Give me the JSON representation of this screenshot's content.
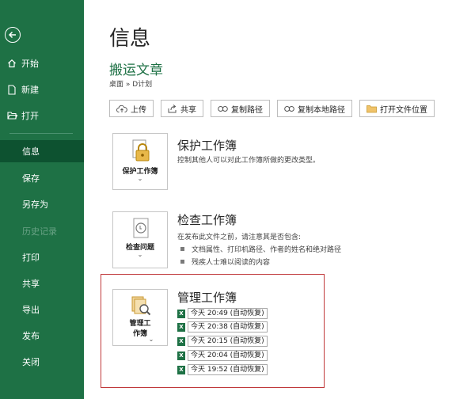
{
  "sidebar": {
    "back_icon": "back-arrow-icon",
    "items": [
      {
        "name": "nav-home",
        "label": "开始",
        "icon": "home-icon"
      },
      {
        "name": "nav-new",
        "label": "新建",
        "icon": "new-document-icon"
      },
      {
        "name": "nav-open",
        "label": "打开",
        "icon": "open-folder-icon"
      },
      {
        "name": "nav-info",
        "label": "信息",
        "active": true
      },
      {
        "name": "nav-save",
        "label": "保存"
      },
      {
        "name": "nav-save-as",
        "label": "另存为"
      },
      {
        "name": "nav-history",
        "label": "历史记录",
        "disabled": true
      },
      {
        "name": "nav-print",
        "label": "打印"
      },
      {
        "name": "nav-share",
        "label": "共享"
      },
      {
        "name": "nav-export",
        "label": "导出"
      },
      {
        "name": "nav-publish",
        "label": "发布"
      },
      {
        "name": "nav-close",
        "label": "关闭"
      }
    ]
  },
  "main": {
    "page_title": "信息",
    "doc_title": "搬运文章",
    "doc_path": "桌面 » D计划",
    "toolbar": [
      {
        "label": "上传",
        "icon": "cloud-upload-icon"
      },
      {
        "label": "共享",
        "icon": "share-icon"
      },
      {
        "label": "复制路径",
        "icon": "link-icon"
      },
      {
        "label": "复制本地路径",
        "icon": "link-icon"
      },
      {
        "label": "打开文件位置",
        "icon": "folder-icon"
      }
    ],
    "protect": {
      "button_label": "保护工作簿",
      "title": "保护工作簿",
      "desc": "控制其他人可以对此工作簿所做的更改类型。"
    },
    "inspect": {
      "button_label": "检查问题",
      "title": "检查工作簿",
      "desc": "在发布此文件之前，请注意其是否包含:",
      "bullets": [
        "文档属性、打印机路径、作者的姓名和绝对路径",
        "残疾人士难以阅读的内容"
      ]
    },
    "manage": {
      "button_label_line1": "管理工",
      "button_label_line2": "作簿",
      "title": "管理工作簿",
      "versions": [
        "今天 20:49 (自动恢复)",
        "今天 20:38 (自动恢复)",
        "今天 20:15 (自动恢复)",
        "今天 20:04 (自动恢复)",
        "今天 19:52 (自动恢复)"
      ]
    }
  },
  "colors": {
    "sidebar": "#1e7145",
    "sidebar_active": "#0d5230",
    "accent": "#1e7145",
    "highlight": "#c0393b"
  }
}
